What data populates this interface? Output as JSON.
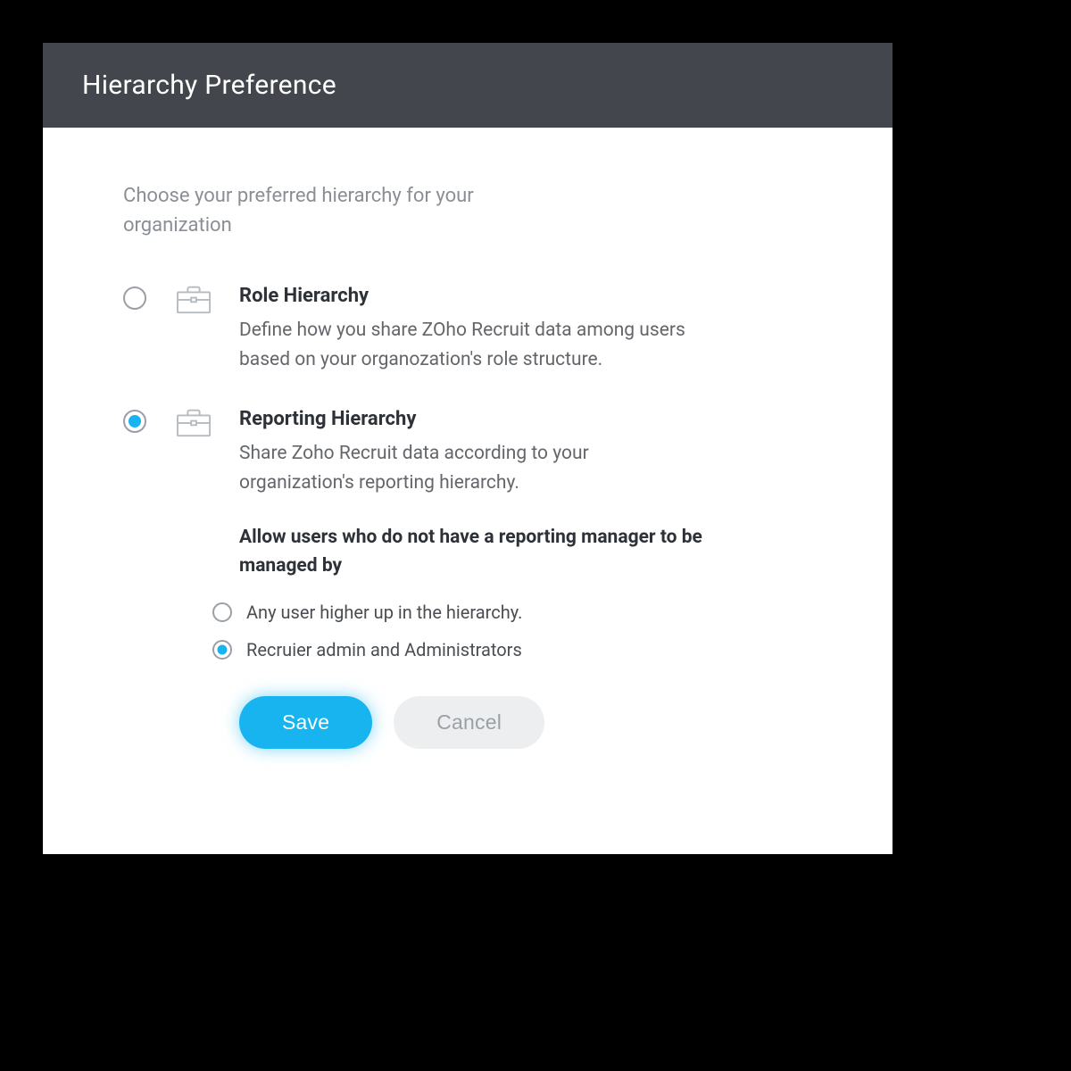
{
  "header": {
    "title": "Hierarchy Preference"
  },
  "intro": "Choose your preferred hierarchy for your organization",
  "options": {
    "role": {
      "title": "Role Hierarchy",
      "desc": "Define how you share ZOho Recruit data among users based on your organozation's role structure.",
      "selected": false
    },
    "reporting": {
      "title": "Reporting Hierarchy",
      "desc": "Share Zoho Recruit data according to your organization's reporting hierarchy.",
      "selected": true,
      "subHeading": "Allow users who do not have a reporting manager to be managed by",
      "subOptions": [
        {
          "label": "Any user higher up in the hierarchy.",
          "selected": false
        },
        {
          "label": "Recruier admin and Administrators",
          "selected": true
        }
      ]
    }
  },
  "buttons": {
    "save": "Save",
    "cancel": "Cancel"
  },
  "colors": {
    "accent": "#17b4f0",
    "headerBg": "#43474d"
  }
}
